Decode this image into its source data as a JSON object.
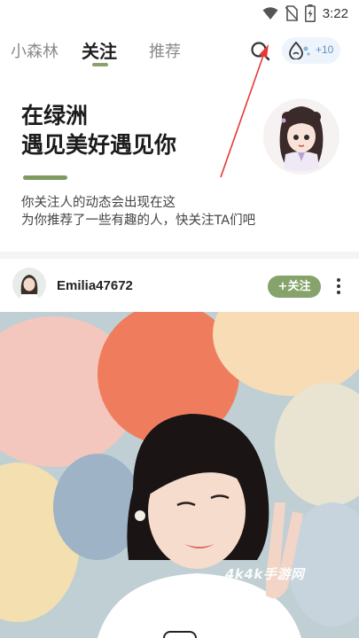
{
  "status_bar": {
    "time": "3:22",
    "icons": [
      "wifi-icon",
      "no-sim-icon",
      "battery-charging-icon"
    ]
  },
  "nav": {
    "tabs": [
      {
        "label": "小森林",
        "active": false
      },
      {
        "label": "关注",
        "active": true
      },
      {
        "label": "推荐",
        "active": false
      }
    ],
    "search_icon": "search-icon",
    "points": {
      "icon": "water-drop-icon",
      "label": "+10"
    }
  },
  "hero": {
    "title_line1": "在绿洲",
    "title_line2": "遇见美好遇见你",
    "subtitle_line1": "你关注人的动态会出现在这",
    "subtitle_line2": "为你推荐了一些有趣的人，快关注TA们吧"
  },
  "post": {
    "username": "Emilia47672",
    "follow_label": "+关注",
    "more_icon": "more-vertical-icon"
  },
  "watermark": "4k4k手游网",
  "colors": {
    "accent_green": "#86a36b",
    "annotation_red": "#e53935",
    "points_blue": "#5f8fbf"
  }
}
